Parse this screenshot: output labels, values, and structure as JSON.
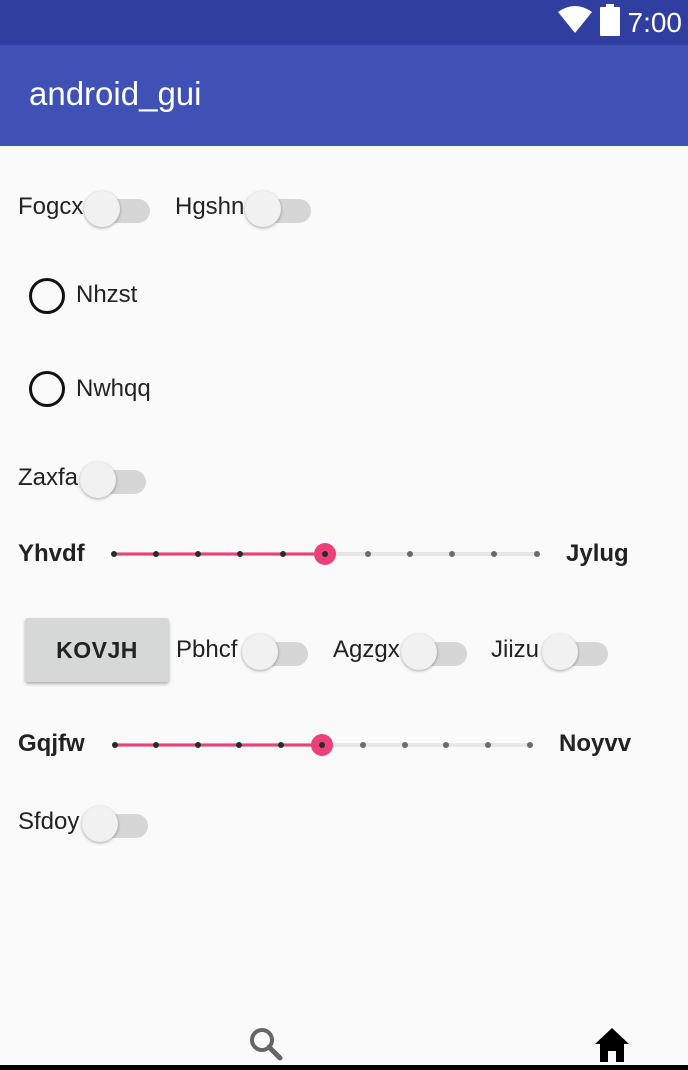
{
  "status_bar": {
    "time": "7:00",
    "wifi_icon": "wifi-icon",
    "battery_icon": "battery-icon"
  },
  "app_bar": {
    "title": "android_gui"
  },
  "switches": [
    {
      "label": "Fogcx",
      "on": false
    },
    {
      "label": "Hgshn",
      "on": false
    },
    {
      "label": "Zaxfa",
      "on": false
    },
    {
      "label": "Pbhcf",
      "on": false
    },
    {
      "label": "Agzgx",
      "on": false
    },
    {
      "label": "Jiizu",
      "on": false
    },
    {
      "label": "Sfdoy",
      "on": false
    }
  ],
  "radios": [
    {
      "label": "Nhzst",
      "checked": false
    },
    {
      "label": "Nwhqq",
      "checked": false
    }
  ],
  "sliders": [
    {
      "left_label": "Yhvdf",
      "right_label": "Jylug",
      "value": 5,
      "max": 10
    },
    {
      "left_label": "Gqjfw",
      "right_label": "Noyvv",
      "value": 5,
      "max": 10
    }
  ],
  "button": {
    "label": "KOVJH"
  },
  "colors": {
    "primary": "#3f51b5",
    "primary_dark": "#303f9f",
    "accent": "#ec407a"
  },
  "bottom_nav": {
    "items": [
      "search-icon",
      "home-icon"
    ]
  }
}
